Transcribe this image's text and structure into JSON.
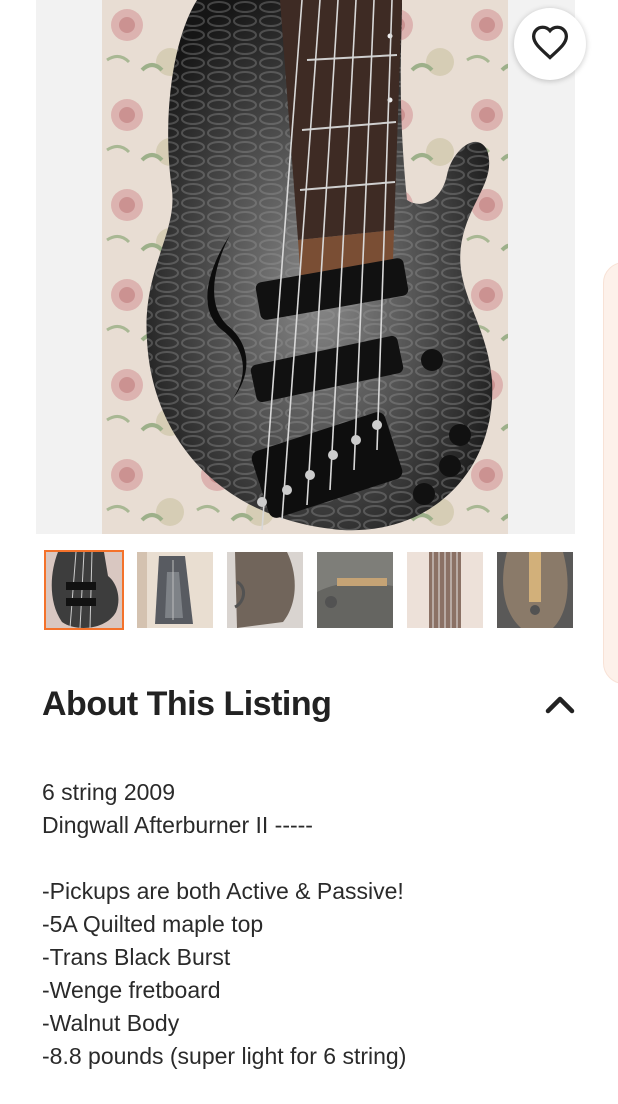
{
  "listing": {
    "hero_image": "bass-guitar-photo",
    "favorite_icon": "heart-outline-icon",
    "accent_color": "#f4722b",
    "thumbnails": [
      {
        "name": "thumb-1",
        "selected": true
      },
      {
        "name": "thumb-2",
        "selected": false
      },
      {
        "name": "thumb-3",
        "selected": false
      },
      {
        "name": "thumb-4",
        "selected": false
      },
      {
        "name": "thumb-5",
        "selected": false
      },
      {
        "name": "thumb-6",
        "selected": false
      }
    ]
  },
  "about": {
    "title": "About This Listing",
    "toggle_icon": "chevron-up-icon",
    "lines": [
      "6 string 2009",
      "Dingwall Afterburner II -----",
      "",
      "-Pickups are both Active & Passive!",
      "-5A Quilted maple top",
      "-Trans Black Burst",
      "-Wenge fretboard",
      "-Walnut Body",
      "-8.8 pounds (super light for 6 string)"
    ]
  }
}
